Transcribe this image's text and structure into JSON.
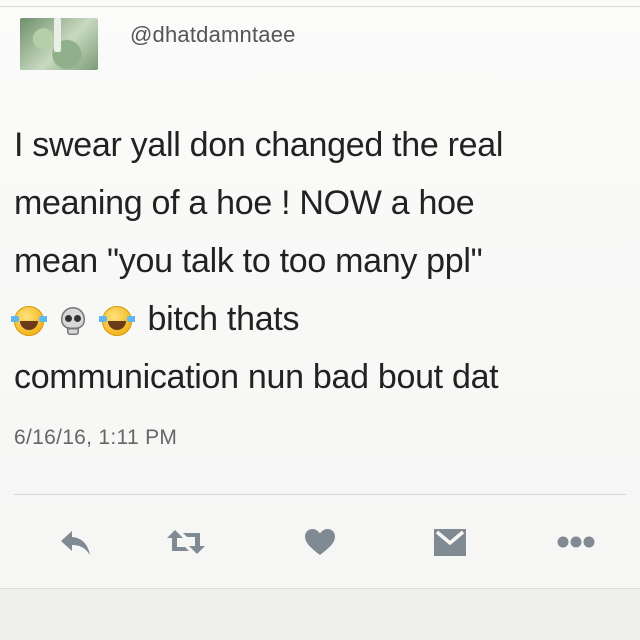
{
  "tweet": {
    "handle": "@dhatdamntaee",
    "lines": [
      "I swear yall don changed the real",
      "meaning of a hoe ! NOW a hoe",
      "mean \"you talk to too many ppl\""
    ],
    "emoji_line": {
      "emojis": [
        "face-with-tears-of-joy",
        "skull",
        "face-with-tears-of-joy"
      ],
      "text": "bitch thats"
    },
    "last_line": "communication nun bad bout dat",
    "timestamp": "6/16/16, 1:11 PM"
  },
  "actions": [
    {
      "name": "reply",
      "icon": "reply-icon"
    },
    {
      "name": "retweet",
      "icon": "retweet-icon"
    },
    {
      "name": "like",
      "icon": "heart-icon"
    },
    {
      "name": "message",
      "icon": "envelope-icon"
    },
    {
      "name": "more",
      "icon": "more-dots-icon"
    }
  ],
  "colors": {
    "icon": "#7f8a93",
    "text": "#222222",
    "muted": "#666666"
  }
}
